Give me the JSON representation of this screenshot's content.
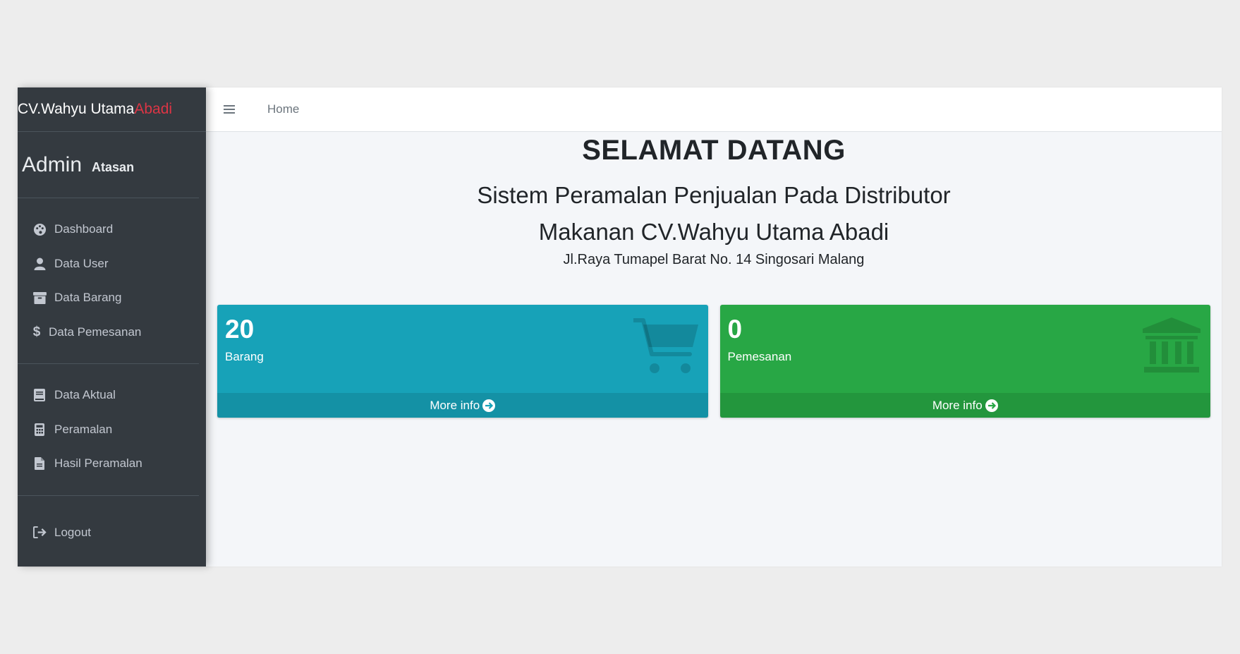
{
  "brand": {
    "name": "CV.Wahyu Utama ",
    "accent": "Abadi"
  },
  "user": {
    "name": "Admin",
    "role": "Atasan"
  },
  "sidebar": {
    "group1": [
      {
        "label": "Dashboard",
        "icon": "palette-icon"
      },
      {
        "label": "Data User",
        "icon": "user-icon"
      },
      {
        "label": "Data Barang",
        "icon": "archive-icon"
      },
      {
        "label": "Data Pemesanan",
        "icon": "dollar-icon"
      }
    ],
    "group2": [
      {
        "label": "Data Aktual",
        "icon": "book-icon"
      },
      {
        "label": "Peramalan",
        "icon": "calculator-icon"
      },
      {
        "label": "Hasil Peramalan",
        "icon": "file-icon"
      }
    ],
    "logout": {
      "label": "Logout",
      "icon": "sign-out-icon"
    }
  },
  "topbar": {
    "menu_icon": "hamburger-icon",
    "home": "Home"
  },
  "welcome": {
    "title": "SELAMAT DATANG",
    "subtitle_line1": "Sistem Peramalan Penjualan Pada Distributor",
    "subtitle_line2": "Makanan CV.Wahyu Utama Abadi",
    "address": "Jl.Raya Tumapel Barat No. 14 Singosari Malang"
  },
  "boxes": [
    {
      "count": "20",
      "label": "Barang",
      "footer": "More info",
      "color": "#17a2b8",
      "icon": "shopping-cart-icon"
    },
    {
      "count": "0",
      "label": "Pemesanan",
      "footer": "More info",
      "color": "#28a745",
      "icon": "university-icon"
    }
  ],
  "colors": {
    "sidebar": "#343a40",
    "accent": "#dc3545",
    "info": "#17a2b8",
    "success": "#28a745"
  }
}
